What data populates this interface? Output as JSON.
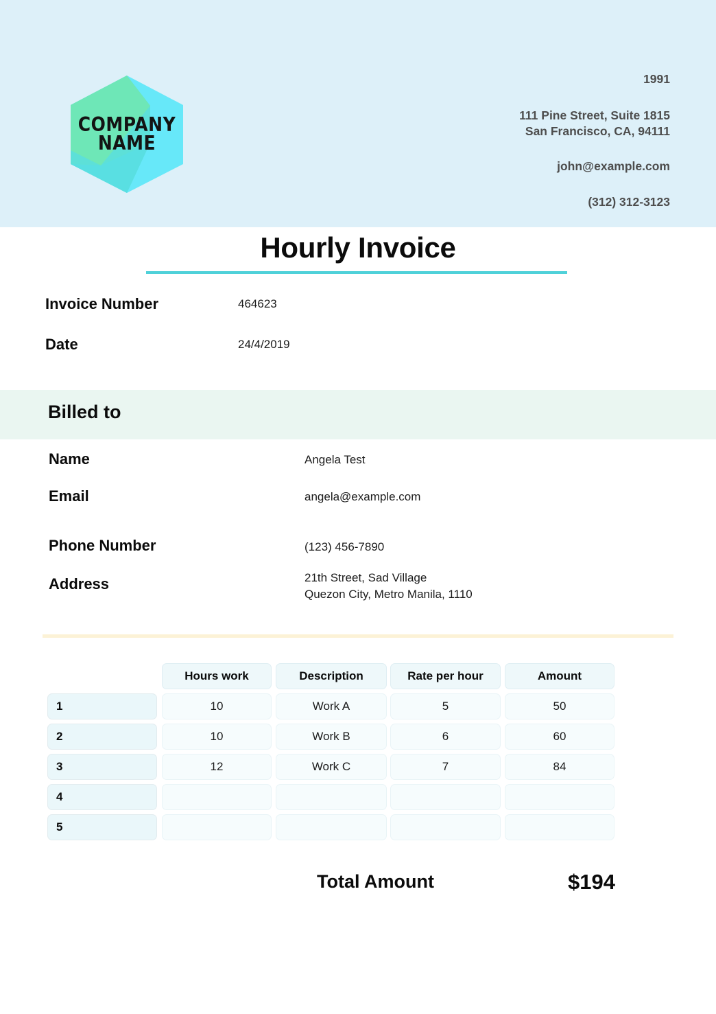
{
  "header": {
    "logo": {
      "icon": "hexagon-logo-icon",
      "line1": "COMPANY",
      "line2": "NAME",
      "color_green": "#6ee7b7",
      "color_cyan": "#67e8f9",
      "color_teal": "#45dbdb"
    },
    "band_color": "#ddf0f9",
    "contact": {
      "year": "1991",
      "address_line1": "111 Pine Street, Suite 1815",
      "address_line2": "San Francisco, CA, 94111",
      "email": "john@example.com",
      "phone": "(312) 312-3123"
    }
  },
  "title": {
    "text": "Hourly Invoice",
    "rule_color": "#4fd1d9"
  },
  "meta": {
    "rows": [
      {
        "label": "Invoice Number",
        "value": "464623"
      },
      {
        "label": "Date",
        "value": "24/4/2019"
      }
    ]
  },
  "billed_to": {
    "section_title": "Billed to",
    "band_color": "#eaf6f1",
    "rows": [
      {
        "label": "Name",
        "value": "Angela Test"
      },
      {
        "label": "Email",
        "value": "angela@example.com"
      },
      {
        "label": "Phone Number",
        "value": "(123) 456-7890"
      },
      {
        "label": "Address",
        "value_line1": "21th Street, Sad Village",
        "value_line2": "Quezon City, Metro Manila, 1110"
      }
    ]
  },
  "divider": {
    "color": "#fcf2d6"
  },
  "table": {
    "headers": {
      "index": "",
      "hours": "Hours work",
      "description": "Description",
      "rate": "Rate per hour",
      "amount": "Amount"
    },
    "rows": [
      {
        "index": "1",
        "hours": "10",
        "description": "Work A",
        "rate": "5",
        "amount": "50"
      },
      {
        "index": "2",
        "hours": "10",
        "description": "Work B",
        "rate": "6",
        "amount": "60"
      },
      {
        "index": "3",
        "hours": "12",
        "description": "Work C",
        "rate": "7",
        "amount": "84"
      },
      {
        "index": "4",
        "hours": "",
        "description": "",
        "rate": "",
        "amount": ""
      },
      {
        "index": "5",
        "hours": "",
        "description": "",
        "rate": "",
        "amount": ""
      }
    ]
  },
  "total": {
    "label": "Total Amount",
    "value": "$194"
  }
}
